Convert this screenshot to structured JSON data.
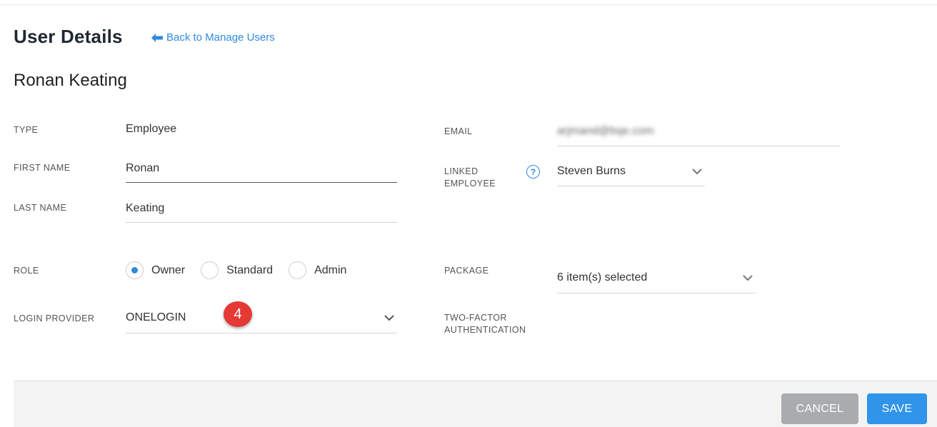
{
  "header": {
    "title": "User Details",
    "back_link": "Back to Manage Users"
  },
  "user": {
    "full_name": "Ronan Keating"
  },
  "form": {
    "type": {
      "label": "TYPE",
      "value": "Employee"
    },
    "first_name": {
      "label": "FIRST NAME",
      "value": "Ronan"
    },
    "last_name": {
      "label": "LAST NAME",
      "value": "Keating"
    },
    "email": {
      "label": "EMAIL",
      "value": "arjmand@bqe.com"
    },
    "linked_employee": {
      "label_line1": "LINKED",
      "label_line2": "EMPLOYEE",
      "help": "?",
      "value": "Steven Burns"
    },
    "role": {
      "label": "ROLE",
      "options": [
        "Owner",
        "Standard",
        "Admin"
      ],
      "selected": "Owner"
    },
    "package": {
      "label": "PACKAGE",
      "value": "6 item(s) selected"
    },
    "login_provider": {
      "label": "LOGIN PROVIDER",
      "value": "ONELOGIN"
    },
    "two_factor": {
      "label_line1": "TWO-FACTOR",
      "label_line2": "AUTHENTICATION"
    }
  },
  "annotation_badge": "4",
  "footer": {
    "cancel_label": "CANCEL",
    "save_label": "SAVE"
  },
  "colors": {
    "accent": "#2f8ae0",
    "save_button": "#2f94ea",
    "cancel_button": "#a9abae",
    "badge": "#e53935"
  },
  "icons": {
    "back": "arrow-left-icon",
    "dropdown": "chevron-down-icon",
    "help": "question-circle-icon"
  }
}
